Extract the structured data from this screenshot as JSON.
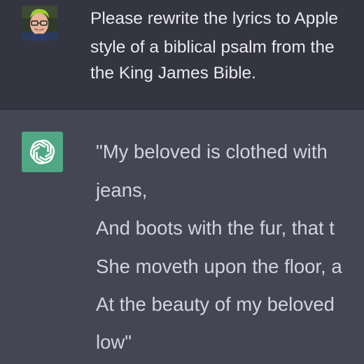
{
  "user_message": {
    "lines": [
      "Please rewrite the lyrics to Apple",
      "style of a biblical psalm from the",
      "the King James Bible."
    ]
  },
  "assistant_message": {
    "lines": [
      "\"My beloved is clothed with",
      "jeans,",
      "And boots with the fur, that t",
      "She moveth upon the floor, a",
      "At the beauty of my beloved",
      "low\""
    ]
  },
  "colors": {
    "user_bg": "#343541",
    "assistant_bg": "#444654",
    "bot_avatar_bg": "#4fa883",
    "text": "#ececf1"
  },
  "icons": {
    "user_avatar": "user-photo-avatar",
    "bot_avatar": "openai-logo-icon"
  }
}
